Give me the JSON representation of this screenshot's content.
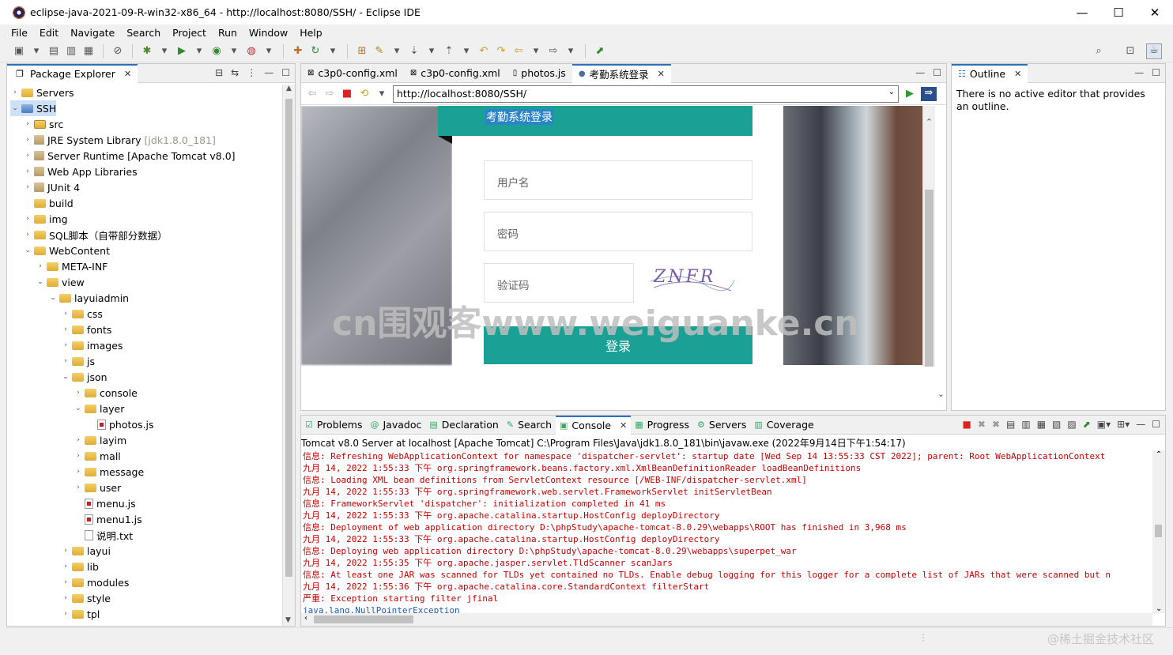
{
  "window": {
    "title": "eclipse-java-2021-09-R-win32-x86_64 - http://localhost:8080/SSH/ - Eclipse IDE"
  },
  "menu": [
    "File",
    "Edit",
    "Navigate",
    "Search",
    "Project",
    "Run",
    "Window",
    "Help"
  ],
  "package_explorer": {
    "tab": "Package Explorer",
    "rows": [
      {
        "label": "Servers",
        "indent": 0,
        "tw": "›",
        "icon": "folder"
      },
      {
        "label": "SSH",
        "indent": 0,
        "tw": "⌄",
        "icon": "project",
        "selected": true
      },
      {
        "label": "src",
        "indent": 1,
        "tw": "›",
        "icon": "pkg"
      },
      {
        "label": "JRE System Library",
        "extra": "[jdk1.8.0_181]",
        "indent": 1,
        "tw": "›",
        "icon": "jar"
      },
      {
        "label": "Server Runtime [Apache Tomcat v8.0]",
        "indent": 1,
        "tw": "›",
        "icon": "jar"
      },
      {
        "label": "Web App Libraries",
        "indent": 1,
        "tw": "›",
        "icon": "jar"
      },
      {
        "label": "JUnit 4",
        "indent": 1,
        "tw": "›",
        "icon": "jar"
      },
      {
        "label": "build",
        "indent": 1,
        "tw": "",
        "icon": "folder"
      },
      {
        "label": "img",
        "indent": 1,
        "tw": "›",
        "icon": "folder"
      },
      {
        "label": "SQL脚本（自带部分数据）",
        "indent": 1,
        "tw": "›",
        "icon": "folder"
      },
      {
        "label": "WebContent",
        "indent": 1,
        "tw": "⌄",
        "icon": "folder"
      },
      {
        "label": "META-INF",
        "indent": 2,
        "tw": "›",
        "icon": "folder"
      },
      {
        "label": "view",
        "indent": 2,
        "tw": "⌄",
        "icon": "folder"
      },
      {
        "label": "layuiadmin",
        "indent": 3,
        "tw": "⌄",
        "icon": "folder"
      },
      {
        "label": "css",
        "indent": 4,
        "tw": "›",
        "icon": "folder"
      },
      {
        "label": "fonts",
        "indent": 4,
        "tw": "›",
        "icon": "folder"
      },
      {
        "label": "images",
        "indent": 4,
        "tw": "›",
        "icon": "folder"
      },
      {
        "label": "js",
        "indent": 4,
        "tw": "›",
        "icon": "folder"
      },
      {
        "label": "json",
        "indent": 4,
        "tw": "⌄",
        "icon": "folder"
      },
      {
        "label": "console",
        "indent": 5,
        "tw": "›",
        "icon": "folder"
      },
      {
        "label": "layer",
        "indent": 5,
        "tw": "⌄",
        "icon": "folder"
      },
      {
        "label": "photos.js",
        "indent": 6,
        "tw": "",
        "icon": "js"
      },
      {
        "label": "layim",
        "indent": 5,
        "tw": "›",
        "icon": "folder"
      },
      {
        "label": "mall",
        "indent": 5,
        "tw": "›",
        "icon": "folder"
      },
      {
        "label": "message",
        "indent": 5,
        "tw": "›",
        "icon": "folder"
      },
      {
        "label": "user",
        "indent": 5,
        "tw": "›",
        "icon": "folder"
      },
      {
        "label": "menu.js",
        "indent": 5,
        "tw": "",
        "icon": "js"
      },
      {
        "label": "menu1.js",
        "indent": 5,
        "tw": "",
        "icon": "js"
      },
      {
        "label": "说明.txt",
        "indent": 5,
        "tw": "",
        "icon": "txt"
      },
      {
        "label": "layui",
        "indent": 4,
        "tw": "›",
        "icon": "folder"
      },
      {
        "label": "lib",
        "indent": 4,
        "tw": "›",
        "icon": "folder"
      },
      {
        "label": "modules",
        "indent": 4,
        "tw": "›",
        "icon": "folder"
      },
      {
        "label": "style",
        "indent": 4,
        "tw": "›",
        "icon": "folder"
      },
      {
        "label": "tpl",
        "indent": 4,
        "tw": "›",
        "icon": "folder"
      }
    ]
  },
  "editor_tabs": [
    "c3p0-config.xml",
    "c3p0-config.xml",
    "photos.js",
    "考勤系统登录"
  ],
  "browser": {
    "url": "http://localhost:8080/SSH/",
    "login_title": "考勤系统登录",
    "username_placeholder": "用户名",
    "password_placeholder": "密码",
    "captcha_placeholder": "验证码",
    "captcha_text": "ZNFR",
    "login_button": "登录"
  },
  "watermark": "cn围观客www.weiguanke.cn",
  "outline": {
    "tab": "Outline",
    "message": "There is no active editor that provides an outline."
  },
  "console": {
    "tabs": [
      "Problems",
      "Javadoc",
      "Declaration",
      "Search",
      "Console",
      "Progress",
      "Servers",
      "Coverage"
    ],
    "header": "Tomcat v8.0 Server at localhost [Apache Tomcat] C:\\Program Files\\Java\\jdk1.8.0_181\\bin\\javaw.exe  (2022年9月14日下午1:54:17)",
    "lines": [
      {
        "t": "信息: Refreshing WebApplicationContext for namespace 'dispatcher-servlet': startup date [Wed Sep 14 13:55:33 CST 2022]; parent: Root WebApplicationContext",
        "c": "red"
      },
      {
        "t": "九月 14, 2022 1:55:33 下午 org.springframework.beans.factory.xml.XmlBeanDefinitionReader loadBeanDefinitions",
        "c": "red"
      },
      {
        "t": "信息: Loading XML bean definitions from ServletContext resource [/WEB-INF/dispatcher-servlet.xml]",
        "c": "red"
      },
      {
        "t": "九月 14, 2022 1:55:33 下午 org.springframework.web.servlet.FrameworkServlet initServletBean",
        "c": "red"
      },
      {
        "t": "信息: FrameworkServlet 'dispatcher': initialization completed in 41 ms",
        "c": "red"
      },
      {
        "t": "九月 14, 2022 1:55:33 下午 org.apache.catalina.startup.HostConfig deployDirectory",
        "c": "red"
      },
      {
        "t": "信息: Deployment of web application directory D:\\phpStudy\\apache-tomcat-8.0.29\\webapps\\ROOT has finished in 3,968 ms",
        "c": "red"
      },
      {
        "t": "九月 14, 2022 1:55:33 下午 org.apache.catalina.startup.HostConfig deployDirectory",
        "c": "red"
      },
      {
        "t": "信息: Deploying web application directory D:\\phpStudy\\apache-tomcat-8.0.29\\webapps\\superpet_war",
        "c": "red"
      },
      {
        "t": "九月 14, 2022 1:55:35 下午 org.apache.jasper.servlet.TldScanner scanJars",
        "c": "red"
      },
      {
        "t": "信息: At least one JAR was scanned for TLDs yet contained no TLDs. Enable debug logging for this logger for a complete list of JARs that were scanned but n",
        "c": "red"
      },
      {
        "t": "九月 14, 2022 1:55:36 下午 org.apache.catalina.core.StandardContext filterStart",
        "c": "red"
      },
      {
        "t": "严重: Exception starting filter jfinal",
        "c": "red"
      },
      {
        "t": "java.lang.NullPointerException",
        "c": "link"
      }
    ]
  },
  "corner_watermark": "@稀土掘金技术社区"
}
